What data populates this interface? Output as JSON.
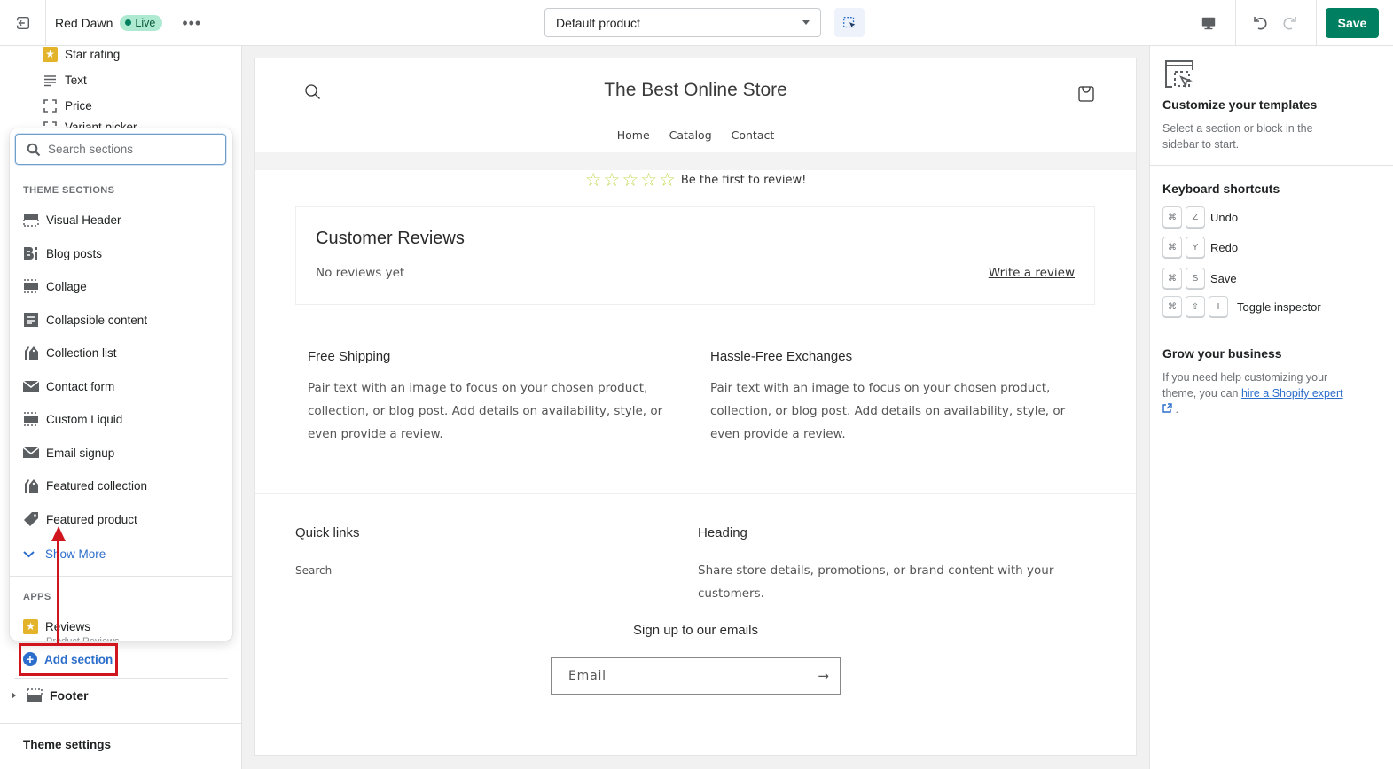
{
  "topbar": {
    "store_name": "Red Dawn",
    "status_badge": "Live",
    "more_label": "•••",
    "template_select": "Default product",
    "save_label": "Save"
  },
  "sidebar": {
    "tree_items": [
      {
        "label": "Star rating",
        "icon": "star-icon"
      },
      {
        "label": "Text",
        "icon": "text-lines-icon"
      },
      {
        "label": "Price",
        "icon": "frame-icon"
      },
      {
        "label": "Variant picker",
        "icon": "frame-icon"
      }
    ],
    "search_placeholder": "Search sections",
    "theme_sections_label": "THEME SECTIONS",
    "theme_sections": [
      {
        "label": "Visual Header",
        "icon": "header-layout-icon"
      },
      {
        "label": "Blog posts",
        "icon": "blog-icon"
      },
      {
        "label": "Collage",
        "icon": "collage-icon"
      },
      {
        "label": "Collapsible content",
        "icon": "collapsible-icon"
      },
      {
        "label": "Collection list",
        "icon": "collection-icon"
      },
      {
        "label": "Contact form",
        "icon": "envelope-icon"
      },
      {
        "label": "Custom Liquid",
        "icon": "custom-liquid-icon"
      },
      {
        "label": "Email signup",
        "icon": "envelope-icon"
      },
      {
        "label": "Featured collection",
        "icon": "collection-icon"
      },
      {
        "label": "Featured product",
        "icon": "tag-icon"
      }
    ],
    "show_more_label": "Show More",
    "apps_label": "APPS",
    "apps": [
      {
        "label": "Reviews",
        "sublabel": "Product Reviews",
        "icon": "star-icon"
      }
    ],
    "add_section_label": "Add section",
    "footer_label": "Footer",
    "theme_settings_label": "Theme settings"
  },
  "preview": {
    "store_title": "The Best Online Store",
    "nav": [
      "Home",
      "Catalog",
      "Contact"
    ],
    "rating_stars": 0,
    "rating_max": 5,
    "rating_text": "Be the first to review!",
    "reviews_heading": "Customer Reviews",
    "no_reviews": "No reviews yet",
    "write_review": "Write a review",
    "columns": [
      {
        "heading": "Free Shipping",
        "text": "Pair text with an image to focus on your chosen product, collection, or blog post. Add details on availability, style, or even provide a review."
      },
      {
        "heading": "Hassle-Free Exchanges",
        "text": "Pair text with an image to focus on your chosen product, collection, or blog post. Add details on availability, style, or even provide a review."
      }
    ],
    "footer": {
      "quick_links_heading": "Quick links",
      "quick_links": [
        "Search"
      ],
      "heading": "Heading",
      "text": "Share store details, promotions, or brand content with your customers.",
      "signup_heading": "Sign up to our emails",
      "email_placeholder": "Email"
    }
  },
  "rpanel": {
    "customize_heading": "Customize your templates",
    "customize_text": "Select a section or block in the sidebar to start.",
    "shortcuts_heading": "Keyboard shortcuts",
    "shortcuts": [
      {
        "keys": [
          "⌘",
          "Z"
        ],
        "label": "Undo"
      },
      {
        "keys": [
          "⌘",
          "Y"
        ],
        "label": "Redo"
      },
      {
        "keys": [
          "⌘",
          "S"
        ],
        "label": "Save"
      },
      {
        "keys": [
          "⌘",
          "⇧",
          "I"
        ],
        "label": "Toggle inspector"
      }
    ],
    "grow_heading": "Grow your business",
    "grow_text_before": "If you need help customizing your theme, you can ",
    "grow_link": "hire a Shopify expert",
    "grow_text_after": " ."
  },
  "colors": {
    "primary_green": "#008060",
    "link_blue": "#2c6ecb",
    "annotation_red": "#d0151f",
    "star_gold": "#e3b32a",
    "review_star": "#c6d958"
  }
}
